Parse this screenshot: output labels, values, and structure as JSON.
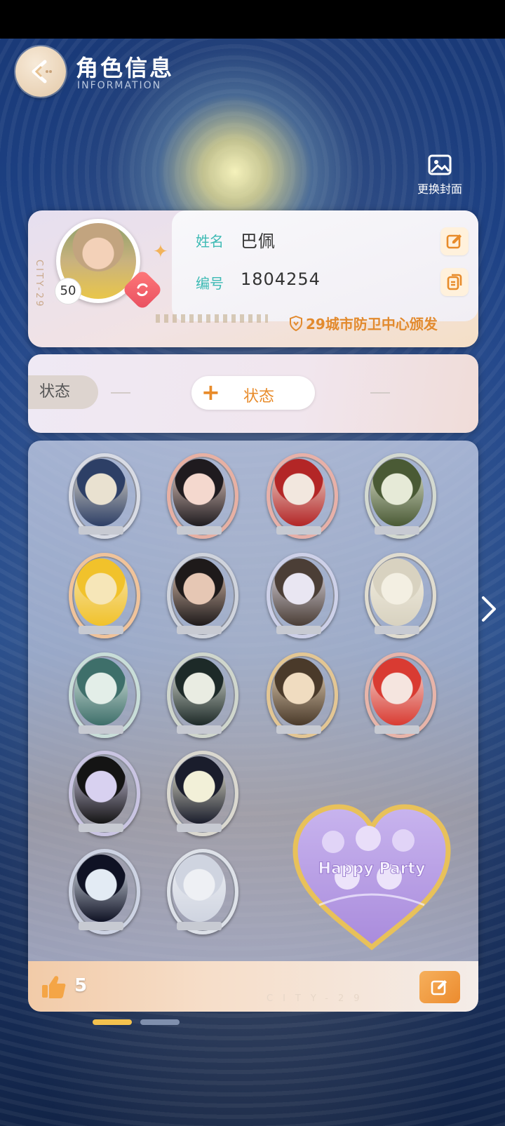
{
  "header": {
    "title": "角色信息",
    "subtitle": "INFORMATION",
    "change_cover_label": "更换封面"
  },
  "profile": {
    "city_code": "CITY-29",
    "level": "50",
    "name_label": "姓名",
    "name_value": "巴佩",
    "id_label": "编号",
    "id_value": "1804254",
    "issuer": "29城市防卫中心颁发"
  },
  "status": {
    "tab_label": "状态",
    "add_label": "状态"
  },
  "badges": [
    {
      "name": "badge-1",
      "frame": "#d8dbe4",
      "tone": [
        "#e9e1d0",
        "#2d3f66"
      ]
    },
    {
      "name": "badge-2",
      "frame": "#e7b0a3",
      "tone": [
        "#f4d8ce",
        "#1f1b1f"
      ]
    },
    {
      "name": "badge-3",
      "frame": "#e7b0a8",
      "tone": [
        "#f2e7de",
        "#b32626"
      ]
    },
    {
      "name": "badge-4",
      "frame": "#d3d9d0",
      "tone": [
        "#e6ead7",
        "#4a5a35"
      ]
    },
    {
      "name": "badge-5",
      "frame": "#f0c39a",
      "tone": [
        "#f6e6b8",
        "#f1c22b"
      ]
    },
    {
      "name": "badge-6",
      "frame": "#cfd3dc",
      "tone": [
        "#e6c7b4",
        "#1e1a1a"
      ]
    },
    {
      "name": "badge-7",
      "frame": "#cdd0e8",
      "tone": [
        "#e9e6f2",
        "#4b3e36"
      ]
    },
    {
      "name": "badge-8",
      "frame": "#e0dccf",
      "tone": [
        "#f3efe2",
        "#d8d2c0"
      ]
    },
    {
      "name": "badge-9",
      "frame": "#c8ddd8",
      "tone": [
        "#e3eee8",
        "#3e6f6a"
      ]
    },
    {
      "name": "badge-10",
      "frame": "#cfd6cc",
      "tone": [
        "#e9ece2",
        "#1d2a28"
      ]
    },
    {
      "name": "badge-11",
      "frame": "#e3c693",
      "tone": [
        "#f0dcc0",
        "#4a3a2a"
      ]
    },
    {
      "name": "badge-12",
      "frame": "#e7b4a9",
      "tone": [
        "#f5e5df",
        "#d93b32"
      ]
    },
    {
      "name": "badge-13",
      "frame": "#c9c4e2",
      "tone": [
        "#d8d1f0",
        "#141414"
      ]
    },
    {
      "name": "badge-14",
      "frame": "#dad8cf",
      "tone": [
        "#f2f0d8",
        "#1a1d2c"
      ]
    },
    {
      "name": "badge-15",
      "frame": "#cdd3e3",
      "tone": [
        "#e3ebf4",
        "#0f1224"
      ]
    },
    {
      "name": "badge-16",
      "frame": "#dde1e8",
      "tone": [
        "#eef0f4",
        "#cfd4e0"
      ]
    }
  ],
  "heart_badge": {
    "text": "Happy Party"
  },
  "footer": {
    "likes": "5",
    "city_text": "CITY-29"
  },
  "colors": {
    "accent_orange": "#e88b2a",
    "label_teal": "#3dbab4",
    "page_dot_active": "#f4c24e",
    "page_dot_inactive": "#7f8fad"
  }
}
